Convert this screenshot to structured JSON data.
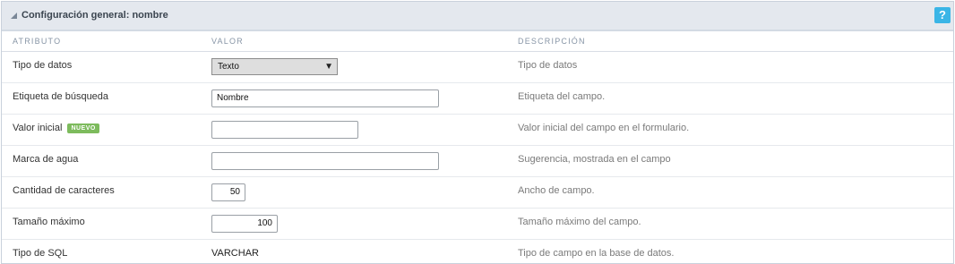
{
  "panel": {
    "title": "Configuración general: nombre",
    "help_label": "?"
  },
  "columns": {
    "attribute": "ATRIBUTO",
    "value": "VALOR",
    "description": "DESCRIPCIÓN"
  },
  "rows": {
    "tipo_datos": {
      "label": "Tipo de datos",
      "value": "Texto",
      "description": "Tipo de datos"
    },
    "etiqueta": {
      "label": "Etiqueta de búsqueda",
      "value": "Nombre",
      "description": "Etiqueta del campo."
    },
    "valor_inicial": {
      "label": "Valor inicial",
      "badge": "NUEVO",
      "value": "",
      "description": "Valor inicial del campo en el formulario."
    },
    "marca_agua": {
      "label": "Marca de agua",
      "value": "",
      "description": "Sugerencia, mostrada en el campo"
    },
    "cantidad": {
      "label": "Cantidad de caracteres",
      "value": "50",
      "description": "Ancho de campo."
    },
    "tamano": {
      "label": "Tamaño máximo",
      "value": "100",
      "description": "Tamaño máximo del campo."
    },
    "tipo_sql": {
      "label": "Tipo de SQL",
      "value": "VARCHAR",
      "description": "Tipo de campo en la base de datos."
    }
  },
  "icons": {
    "collapse": "collapse-triangle-icon",
    "help": "help-icon",
    "dropdown": "dropdown-arrow-icon"
  },
  "colors": {
    "header_bg": "#e4e8ee",
    "help_bg": "#3ab5e6",
    "badge_bg": "#7dbb5d"
  }
}
